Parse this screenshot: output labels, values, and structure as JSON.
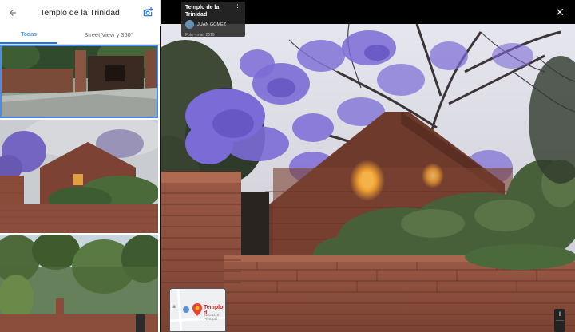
{
  "panel": {
    "title": "Templo de la Trinidad",
    "tabs": [
      {
        "label": "Todas",
        "active": true
      },
      {
        "label": "Street View y 360°",
        "active": false
      }
    ]
  },
  "viewer": {
    "place_title": "Templo de la Trinidad",
    "author_name": "JUAN GOMEZ",
    "date_text": "Foto - mar. 2019",
    "map": {
      "place_label": "Templo d",
      "sub_label": "22 Guzzo\nPrincipal",
      "side_label": "ia"
    },
    "zoom_in_label": "+"
  },
  "colors": {
    "accent": "#1a73e8",
    "selected_border": "#4a8af4",
    "jacaranda": "#7b6bd6",
    "brick": "#8a4a38"
  },
  "icons": [
    "back-arrow-icon",
    "add-photo-icon",
    "collapse-arrow-icon",
    "more-options-icon",
    "close-icon",
    "map-pin-icon"
  ]
}
